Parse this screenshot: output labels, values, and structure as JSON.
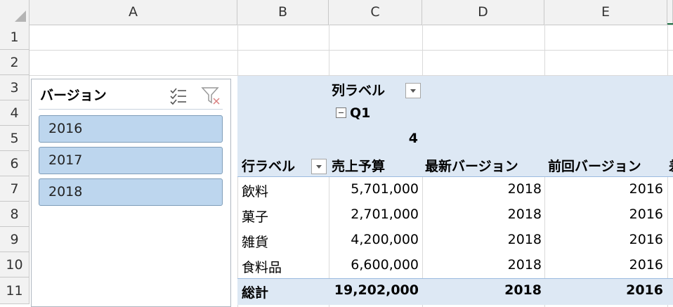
{
  "columns": [
    "A",
    "B",
    "C",
    "D",
    "E"
  ],
  "rows": [
    "1",
    "2",
    "3",
    "4",
    "5",
    "6",
    "7",
    "8",
    "9",
    "10",
    "11"
  ],
  "slicer": {
    "title": "バージョン",
    "items": [
      "2016",
      "2017",
      "2018"
    ],
    "multiselect_icon": "multi-select-icon",
    "clear_filter_icon": "clear-filter-icon"
  },
  "pivot": {
    "column_labels": "列ラベル",
    "quarter": "Q1",
    "quarter_sub": "4",
    "row_labels": "行ラベル",
    "headers": [
      "売上予算",
      "最新バージョン",
      "前回バージョン"
    ],
    "headers_cut": "差",
    "rows": [
      {
        "label": "飲料",
        "budget": "5,701,000",
        "latest": "2018",
        "previous": "2016"
      },
      {
        "label": "菓子",
        "budget": "2,701,000",
        "latest": "2018",
        "previous": "2016"
      },
      {
        "label": "雑貨",
        "budget": "4,200,000",
        "latest": "2018",
        "previous": "2016"
      },
      {
        "label": "食料品",
        "budget": "6,600,000",
        "latest": "2018",
        "previous": "2016"
      }
    ],
    "total": {
      "label": "総計",
      "budget": "19,202,000",
      "latest": "2018",
      "previous": "2016"
    }
  },
  "colors": {
    "pivot_band": "#dde8f4",
    "slicer_item": "#bdd6ee",
    "header_bg": "#f2f2f2",
    "selection": "#217346"
  }
}
